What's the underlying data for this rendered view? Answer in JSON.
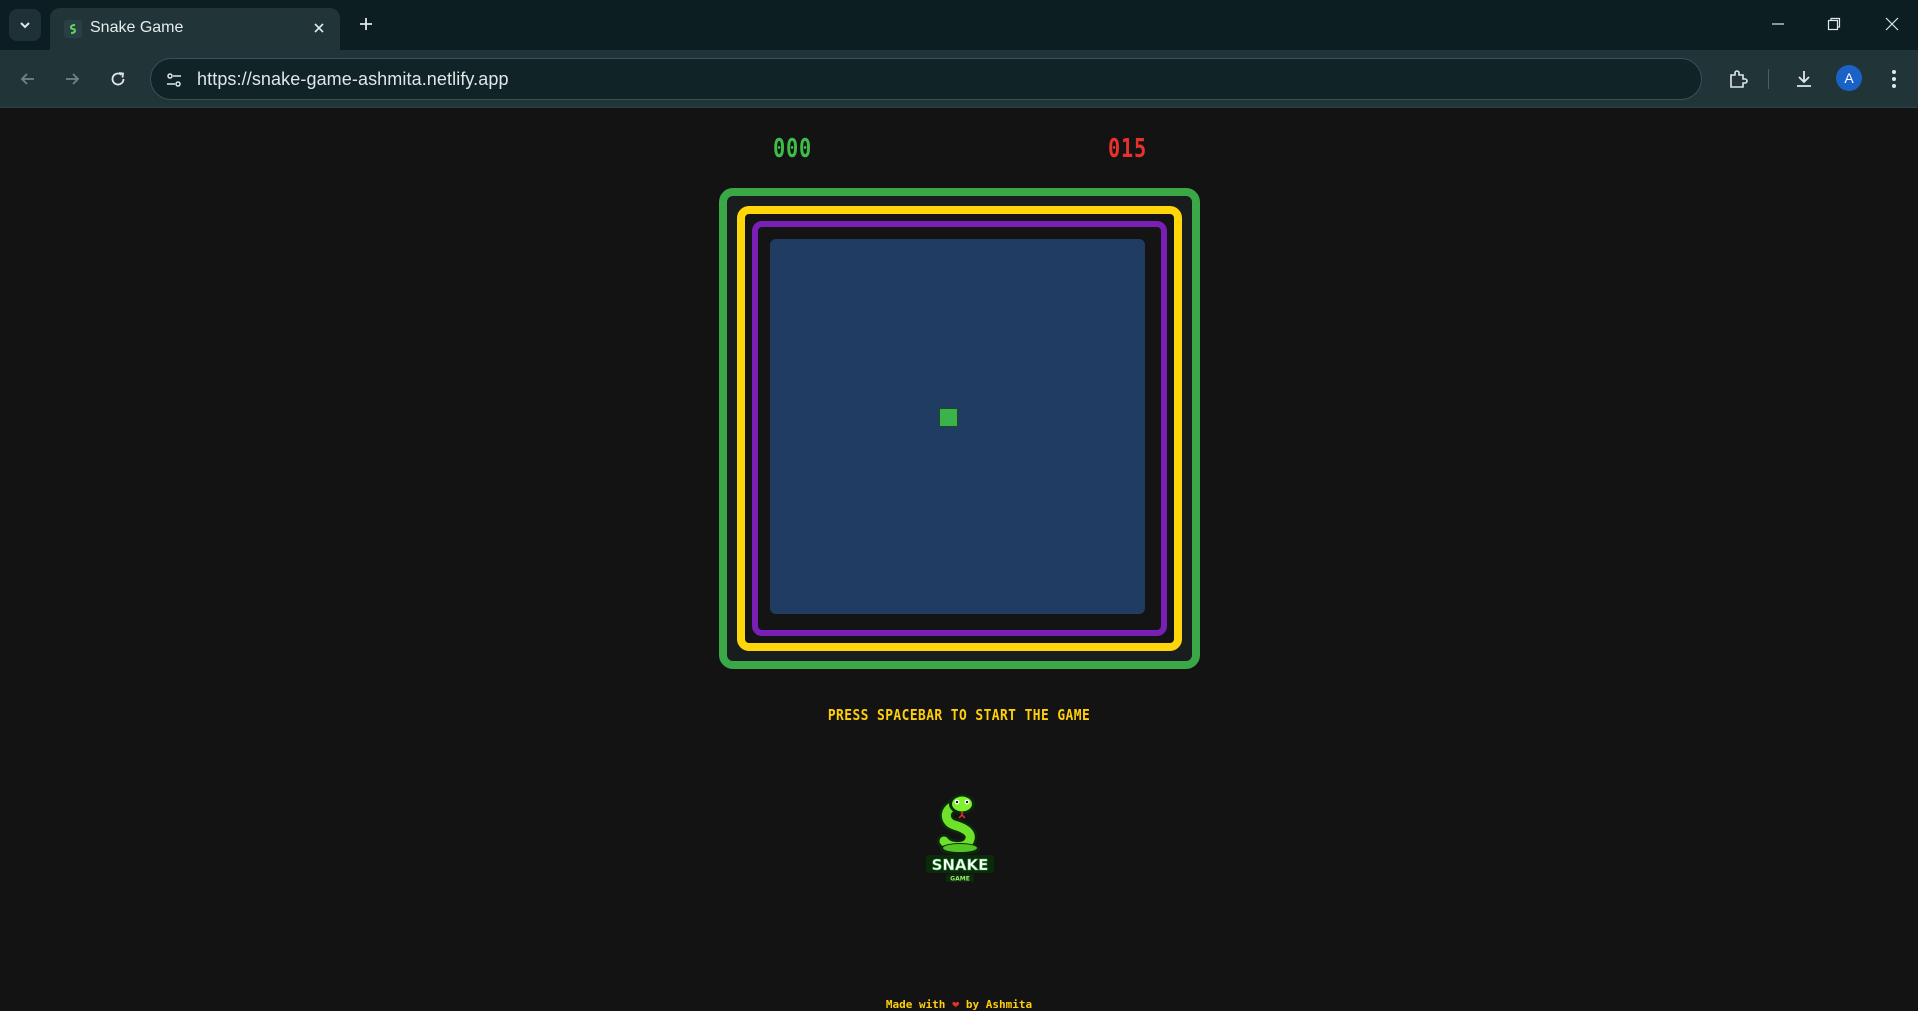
{
  "browser": {
    "tab_title": "Snake Game",
    "url": "https://snake-game-ashmita.netlify.app",
    "profile_initial": "A",
    "icons": {
      "tab_search": "chevron-down-icon",
      "favicon": "snake-favicon",
      "close_tab": "close-icon",
      "new_tab": "plus-icon",
      "back": "back-arrow-icon",
      "forward": "forward-arrow-icon",
      "reload": "reload-icon",
      "site_info": "tune-icon",
      "extensions": "puzzle-icon",
      "downloads": "download-icon",
      "menu": "kebab-menu-icon",
      "minimize": "minimize-icon",
      "restore": "restore-icon",
      "close_window": "close-icon"
    }
  },
  "game": {
    "score": "000",
    "high_score": "015",
    "instruction": "PRESS SPACEBAR TO START THE GAME",
    "logo_text": "SNAKE",
    "logo_subtext": "GAME",
    "footer": {
      "prefix": "Made with",
      "suffix": "by Ashmita"
    },
    "colors": {
      "score": "#3dbd48",
      "high_score": "#e8312d",
      "frame_outer": "#3aa846",
      "frame_middle": "#ffd60a",
      "frame_inner": "#7a1fb5",
      "board": "#213c62",
      "food": "#3bb34a",
      "text_accent": "#ffcf0a"
    }
  }
}
